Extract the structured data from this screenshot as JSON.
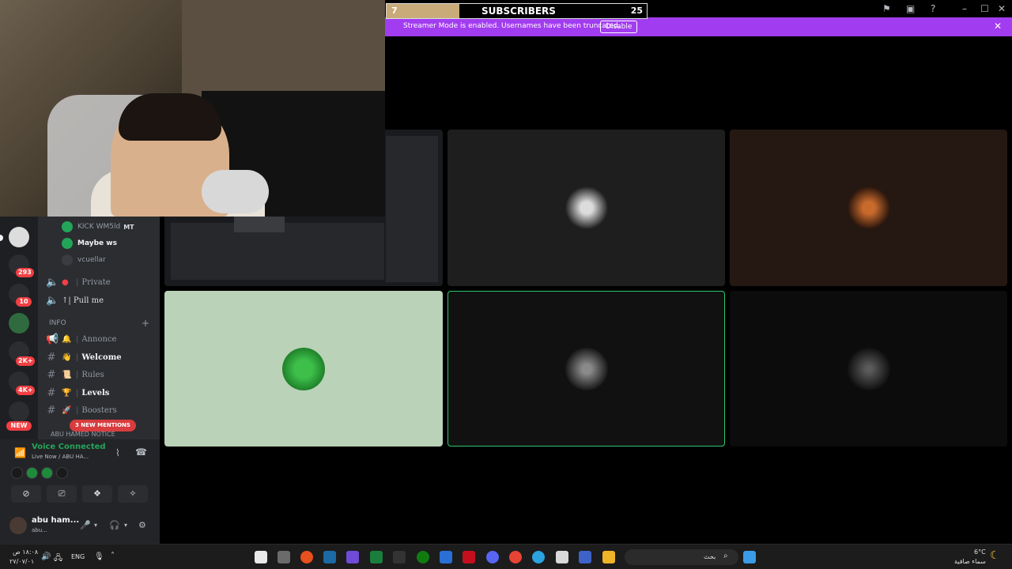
{
  "overlay": {
    "subscribers": {
      "current": "7",
      "label": "SUBSCRIBERS",
      "goal": "25",
      "progress": 0.28
    }
  },
  "banner": {
    "message": "Streamer Mode is enabled. Usernames have been truncated.",
    "disable_label": "Disable",
    "color": "#a23cf0"
  },
  "server_rail": {
    "badges": [
      "293",
      "10",
      "2K+",
      "4K+"
    ],
    "new_label": "NEW"
  },
  "channels": {
    "voice_users": [
      {
        "name": "KICK WM5ld",
        "tag": "MT"
      },
      {
        "name": "Maybe ws"
      },
      {
        "name": "vcuellar"
      }
    ],
    "voice_channels": [
      {
        "name": "Private"
      },
      {
        "name": "↑| Pull me"
      }
    ],
    "category": "INFO",
    "text_channels": [
      {
        "emoji": "🔔",
        "name": "Annonce"
      },
      {
        "emoji": "👋",
        "name": "Welcome"
      },
      {
        "emoji": "📜",
        "name": "Rules"
      },
      {
        "emoji": "🏆",
        "name": "Levels"
      },
      {
        "emoji": "🚀",
        "name": "Boosters"
      }
    ],
    "mentions": "3 NEW MENTIONS",
    "category2": "ABU HAMED NOTICE"
  },
  "voice_panel": {
    "status": "Voice Connected",
    "channel": "Live Now / ABU HA...",
    "user_name": "abu ham...",
    "user_status": "abu..."
  },
  "taskbar": {
    "time": "١٨:٠٨ ص",
    "date": "٢٧/٠٧/٠١",
    "lang": "ENG",
    "search_placeholder": "بحث",
    "weather_temp": "6°C",
    "weather_desc": "سماء صافية"
  }
}
